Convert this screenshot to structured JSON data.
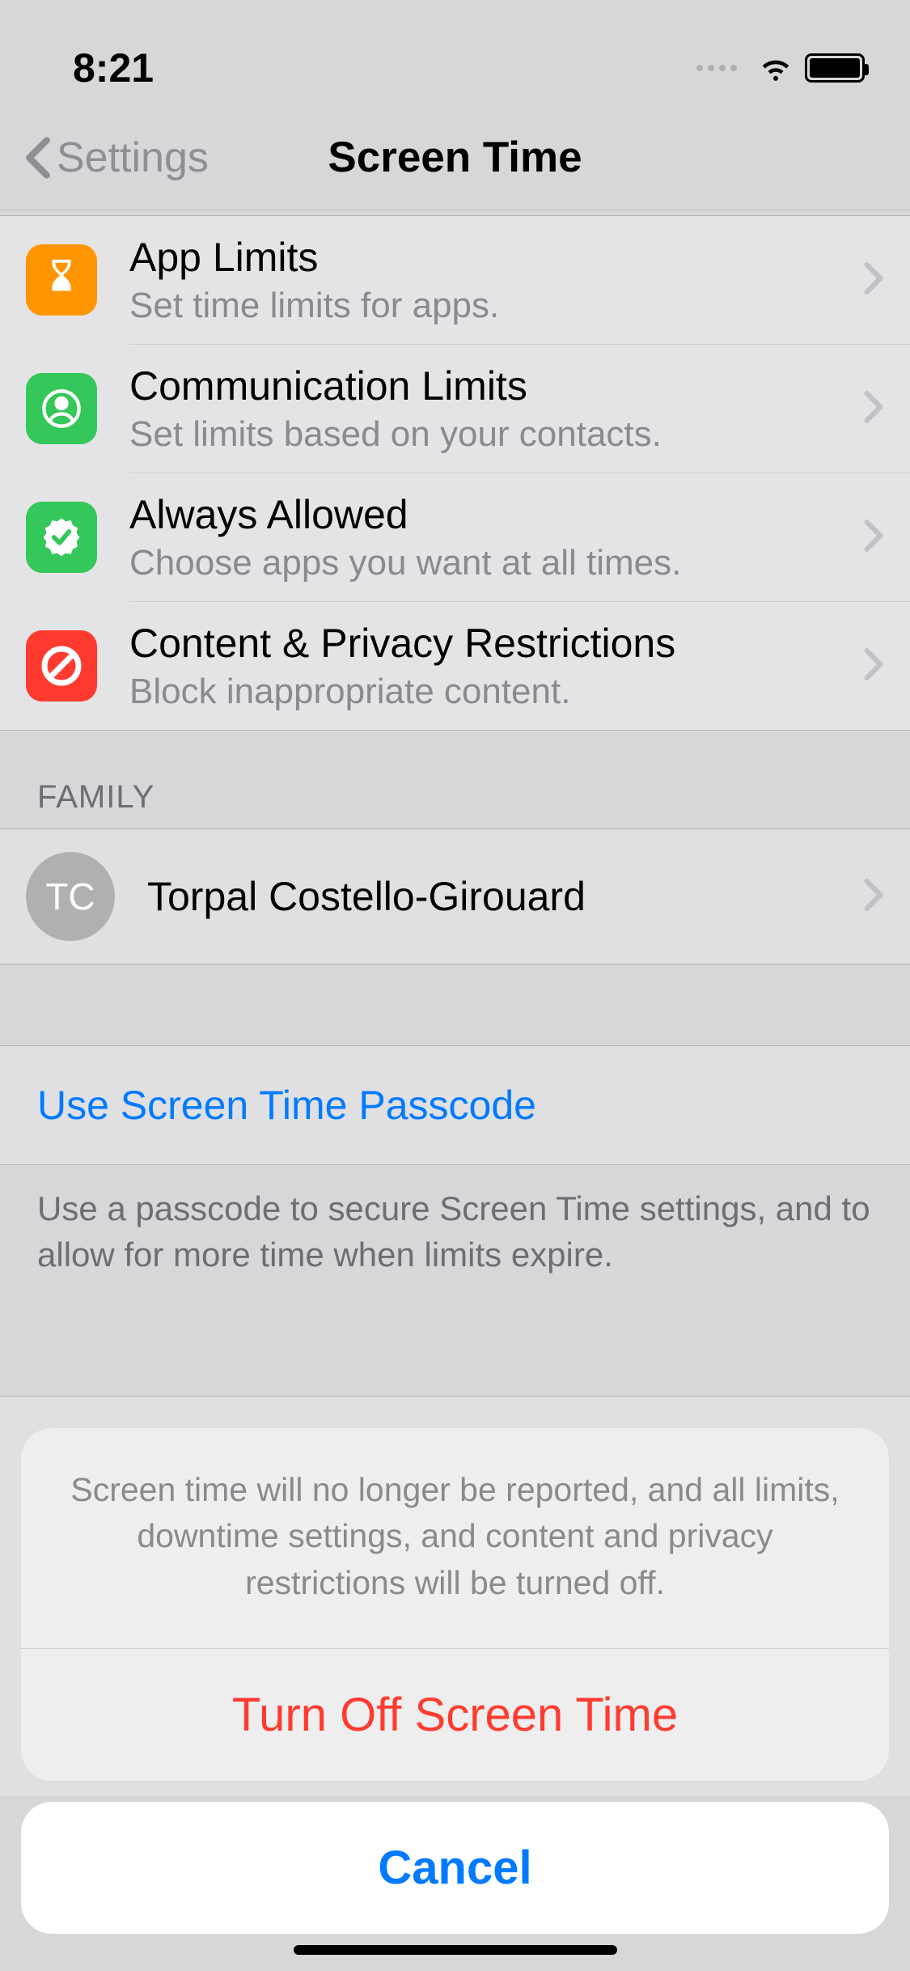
{
  "status": {
    "time": "8:21"
  },
  "nav": {
    "back": "Settings",
    "title": "Screen Time"
  },
  "rows": {
    "app_limits": {
      "title": "App Limits",
      "sub": "Set time limits for apps."
    },
    "comm_limits": {
      "title": "Communication Limits",
      "sub": "Set limits based on your contacts."
    },
    "always": {
      "title": "Always Allowed",
      "sub": "Choose apps you want at all times."
    },
    "content": {
      "title": "Content & Privacy Restrictions",
      "sub": "Block inappropriate content."
    }
  },
  "family": {
    "header": "FAMILY",
    "initials": "TC",
    "name": "Torpal Costello-Girouard"
  },
  "passcode": {
    "link": "Use Screen Time Passcode",
    "footer": "Use a passcode to secure Screen Time settings, and to allow for more time when limits expire."
  },
  "turn_off_row": "Turn Off Screen Time",
  "sheet": {
    "message": "Screen time will no longer be reported, and all limits, downtime settings, and content and privacy restrictions will be turned off.",
    "action": "Turn Off Screen Time",
    "cancel": "Cancel"
  }
}
